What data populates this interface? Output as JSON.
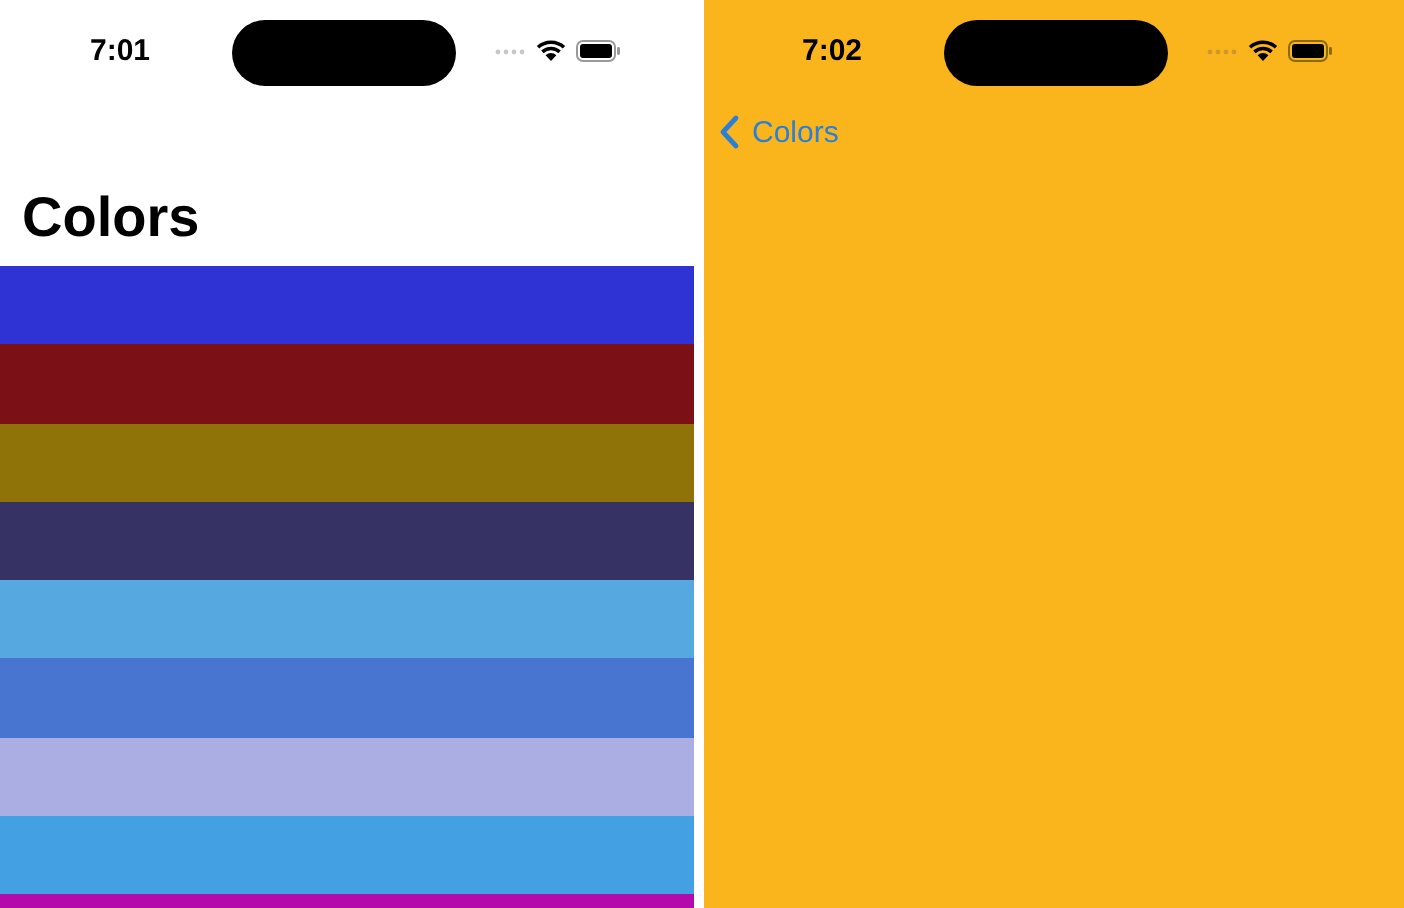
{
  "screens": [
    {
      "kind": "list",
      "time": "7:01",
      "title": "Colors",
      "colors": [
        {
          "color": "#2f33d4"
        },
        {
          "color": "#7b1016"
        },
        {
          "color": "#8f7208"
        },
        {
          "color": "#373264"
        },
        {
          "color": "#55a8e0"
        },
        {
          "color": "#4775cf"
        },
        {
          "color": "#abaee2"
        },
        {
          "color": "#43a0e3"
        },
        {
          "color": "#b40aac"
        }
      ]
    },
    {
      "kind": "detail",
      "time": "7:02",
      "back": "Colors",
      "color": "#fbb51c"
    }
  ]
}
